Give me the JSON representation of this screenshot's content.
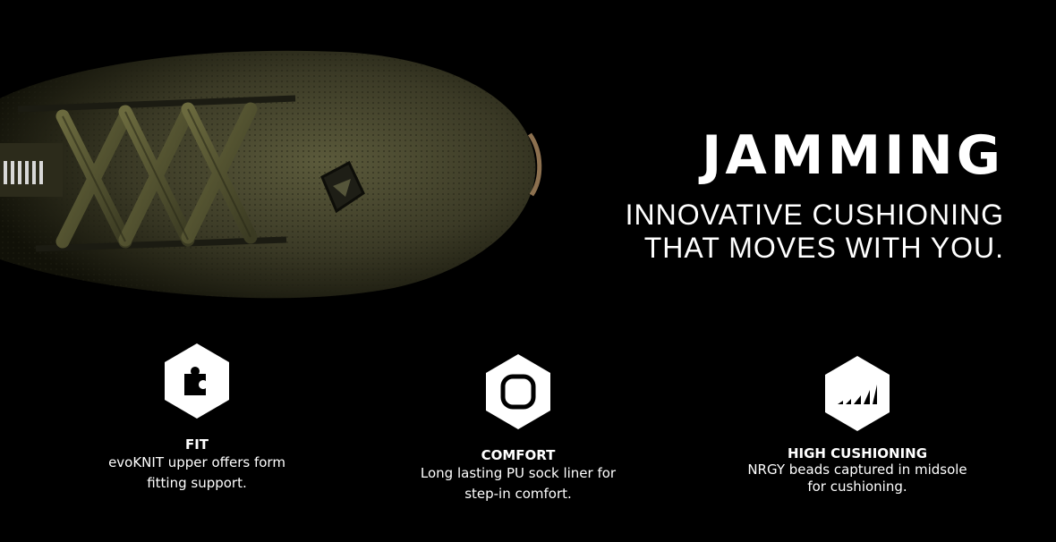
{
  "hero": {
    "title": "JAMMING",
    "subtitle_line1": "INNOVATIVE CUSHIONING",
    "subtitle_line2": "THAT MOVES WITH YOU."
  },
  "features": [
    {
      "icon": "puzzle-piece-icon",
      "title": "FIT",
      "description_line1": "evoKNIT upper offers form",
      "description_line2": "fitting support."
    },
    {
      "icon": "rounded-square-icon",
      "title": "COMFORT",
      "description_line1": "Long lasting PU sock liner for",
      "description_line2": "step-in comfort."
    },
    {
      "icon": "signal-bars-icon",
      "title": "HIGH CUSHIONING",
      "description_line1": "NRGY beads captured in midsole",
      "description_line2": "for cushioning."
    }
  ],
  "colors": {
    "background": "#000000",
    "text": "#ffffff",
    "shoe_knit": "#4a4a30",
    "shoe_lace": "#5a5a34"
  }
}
